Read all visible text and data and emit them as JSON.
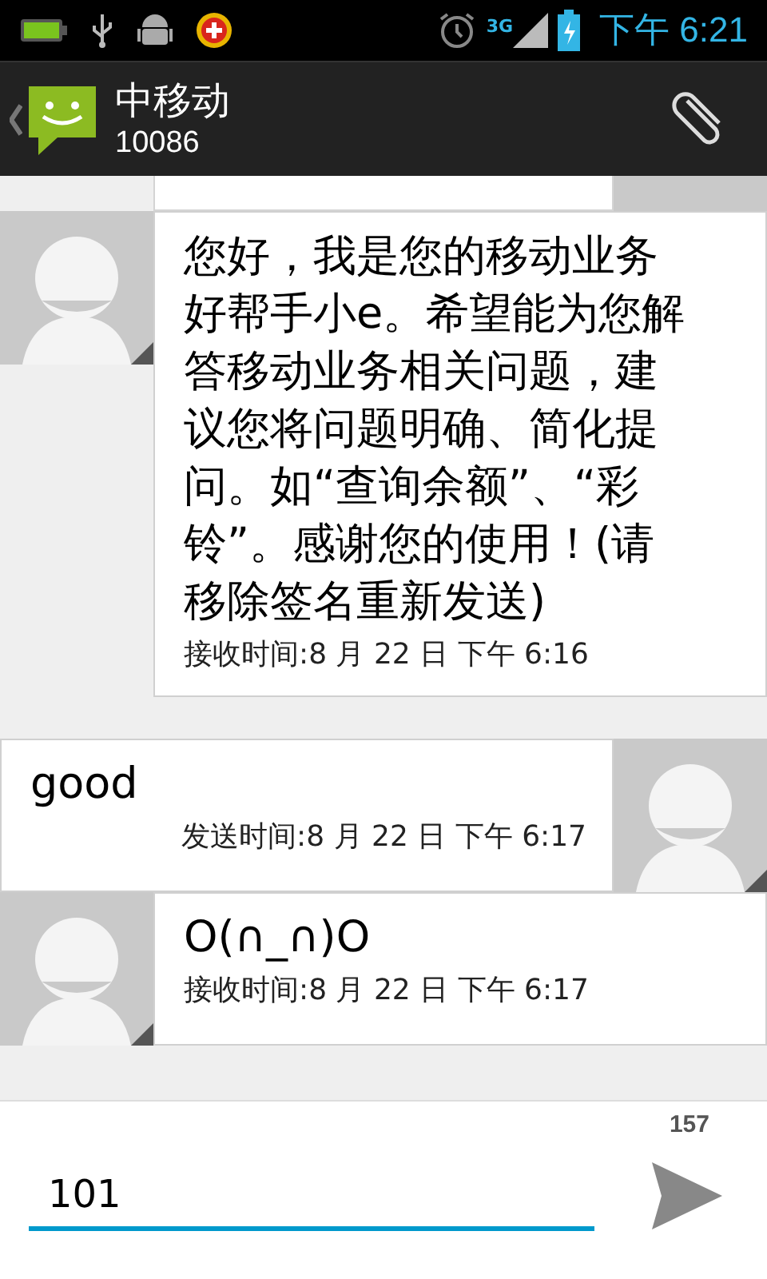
{
  "status_bar": {
    "time": "下午 6:21",
    "network": "3G"
  },
  "header": {
    "title": "中移动",
    "subtitle": "10086"
  },
  "messages": [
    {
      "kind": "received",
      "text": "您好，我是您的移动业务好帮手小e。希望能为您解答移动业务相关问题，建议您将问题明确、简化提问。如“查询余额”、“彩铃”。感谢您的使用！(请移除签名重新发送)",
      "time": "接收时间:8 月 22 日 下午 6:16"
    },
    {
      "kind": "sent",
      "text": "good",
      "time": "发送时间:8 月 22 日 下午 6:17"
    },
    {
      "kind": "received",
      "text": "O(∩_∩)O",
      "time": "接收时间:8 月 22 日 下午 6:17"
    }
  ],
  "compose": {
    "value": "101",
    "counter": "157"
  }
}
